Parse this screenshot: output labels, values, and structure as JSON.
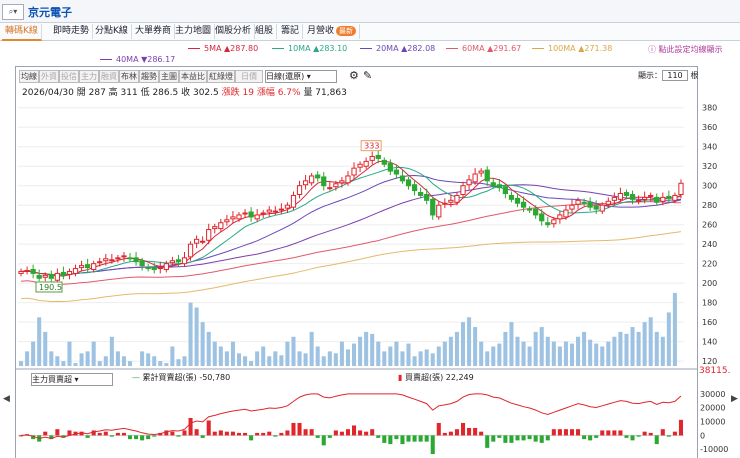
{
  "topbar": {
    "search_icon": "⌕▾",
    "stock_name": "京元電子"
  },
  "tabs": [
    {
      "label": "轉碼K線",
      "active": true
    },
    {
      "label": "即時走勢"
    },
    {
      "label": "分點K線"
    },
    {
      "label": "大單券商"
    },
    {
      "label": "主力地圖"
    },
    {
      "label": "個股分析"
    },
    {
      "label": "組股"
    },
    {
      "label": "籌記"
    },
    {
      "label": "月營收",
      "badge": "最新"
    }
  ],
  "ma": [
    {
      "label": "5MA ▲287.80",
      "color": "#d7263d"
    },
    {
      "label": "10MA ▲283.10",
      "color": "#2aa889"
    },
    {
      "label": "20MA ▲282.08",
      "color": "#6a48b8"
    },
    {
      "label": "60MA ▲291.67",
      "color": "#e05a6b"
    },
    {
      "label": "100MA ▲271.38",
      "color": "#e6b96a"
    },
    {
      "label": "40MA ▼286.17",
      "color": "#7a3fb0"
    }
  ],
  "hint": "ⓘ 點此設定均線顯示",
  "toolbar": {
    "buttons": [
      "均線",
      "外資",
      "投信",
      "主力",
      "融資",
      "布林",
      "趨勢",
      "主圖",
      "本益比",
      "紅綠燈",
      "日價"
    ],
    "select": "日線(還原)",
    "display_label": "顯示：",
    "display_value": "110",
    "display_unit": "根"
  },
  "ohlc": {
    "date": "2026/04/30",
    "open": "開 287",
    "high": "高 311",
    "low": "低 286.5",
    "close": "收 302.5",
    "change": "漲跌 19",
    "pct": "漲幅 6.7%",
    "volume": "量 71,863"
  },
  "chart_data": {
    "type": "candlestick",
    "y_ticks": [
      380,
      360,
      340,
      320,
      300,
      280,
      260,
      240,
      220,
      200,
      180,
      160,
      140,
      120
    ],
    "max_label": "333",
    "min_label": "190.5",
    "close_series": [
      212,
      213,
      210,
      205,
      208,
      205,
      210,
      208,
      212,
      215,
      218,
      216,
      220,
      222,
      225,
      224,
      226,
      228,
      225,
      222,
      218,
      215,
      214,
      216,
      220,
      223,
      222,
      226,
      240,
      245,
      243,
      255,
      258,
      262,
      265,
      268,
      270,
      272,
      268,
      270,
      272,
      275,
      274,
      276,
      280,
      290,
      300,
      305,
      310,
      308,
      300,
      298,
      302,
      305,
      310,
      318,
      322,
      325,
      330,
      328,
      322,
      315,
      312,
      305,
      300,
      295,
      290,
      285,
      270,
      280,
      282,
      285,
      290,
      300,
      306,
      312,
      315,
      305,
      300,
      298,
      292,
      286,
      282,
      278,
      275,
      270,
      264,
      260,
      265,
      270,
      275,
      280,
      285,
      282,
      278,
      276,
      280,
      284,
      288,
      292,
      290,
      286,
      285,
      288,
      290,
      283,
      288,
      287,
      290,
      302.5
    ],
    "volume_series": [
      120,
      130,
      140,
      165,
      150,
      130,
      125,
      120,
      140,
      118,
      128,
      130,
      140,
      120,
      125,
      145,
      130,
      125,
      120,
      115,
      130,
      128,
      125,
      120,
      118,
      135,
      122,
      125,
      180,
      175,
      160,
      150,
      140,
      135,
      130,
      140,
      128,
      125,
      120,
      130,
      135,
      125,
      130,
      126,
      140,
      145,
      130,
      128,
      150,
      135,
      125,
      130,
      128,
      140,
      132,
      138,
      145,
      150,
      148,
      140,
      130,
      135,
      140,
      130,
      138,
      125,
      130,
      132,
      128,
      135,
      140,
      145,
      150,
      160,
      165,
      155,
      140,
      130,
      135,
      138,
      150,
      160,
      145,
      140,
      135,
      150,
      155,
      145,
      140,
      135,
      140,
      138,
      145,
      150,
      142,
      138,
      135,
      140,
      145,
      150,
      148,
      155,
      150,
      160,
      165,
      150,
      145,
      170,
      190
    ],
    "indicator": {
      "name": "主力買賣超",
      "cum_label": "累計買賣超(張) -50,780",
      "daily_label": "買賣超(張) 22,249",
      "current": "38115.",
      "y_ticks": [
        "30000",
        "20000",
        "10000",
        "0",
        "-10000"
      ]
    }
  }
}
